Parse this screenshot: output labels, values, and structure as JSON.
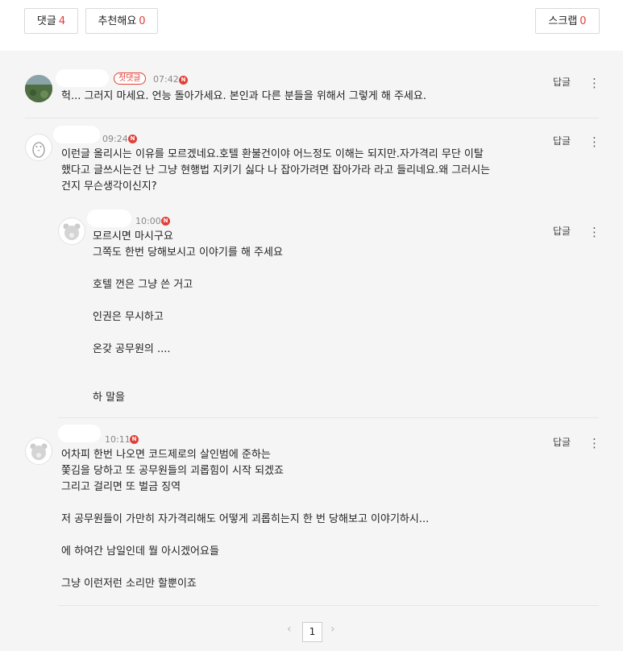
{
  "toolbar": {
    "comment_label": "댓글",
    "comment_count": "4",
    "recommend_label": "추천해요",
    "recommend_count": "0",
    "scrap_label": "스크랩",
    "scrap_count": "0"
  },
  "comments": [
    {
      "badge": "첫댓글",
      "time": "07:42",
      "new_mark": "N",
      "reply_label": "답글",
      "more_glyph": "⋮",
      "text": "헉... 그러지 마세요. 언능 돌아가세요. 본인과 다른 분들을 위해서 그렇게 해 주세요."
    },
    {
      "time": "09:24",
      "new_mark": "N",
      "reply_label": "답글",
      "more_glyph": "⋮",
      "text": "이런글 올리시는 이유를 모르겠네요.호텔 환불건이야 어느정도 이해는 되지만.자가격리 무단 이탈\n했다고 글쓰시는건 난 그냥 현행법 지키기 싫다 나 잡아가려면 잡아가라 라고 들리네요.왜 그러시는\n건지 무슨생각이신지?"
    },
    {
      "time": "10:00",
      "new_mark": "N",
      "reply_label": "답글",
      "more_glyph": "⋮",
      "text": "모르시면 마시구요\n그쪽도 한번 당해보시고 이야기를 해 주세요\n\n호텔 껀은 그냥 쓴 거고\n\n인권은 무시하고\n\n온갖 공무원의 ....\n\n\n하 말을"
    },
    {
      "time": "10:11",
      "new_mark": "N",
      "reply_label": "답글",
      "more_glyph": "⋮",
      "text": "어차피 한번 나오면 코드제로의 살인범에 준하는\n쫓김을 당하고 또 공무원들의 괴롭힘이 시작 되겠죠\n그리고 걸리면 또 벌금 징역\n\n저 공무원들이 가만히 자가격리해도 어떻게 괴롭히는지 한 번 당해보고 이야기하시...\n\n에 하여간 남일인데 뭘 아시겠어요들\n\n그냥 이런저런 소리만 할뿐이죠"
    }
  ],
  "pagination": {
    "prev": "‹",
    "current": "1",
    "next": "›"
  }
}
